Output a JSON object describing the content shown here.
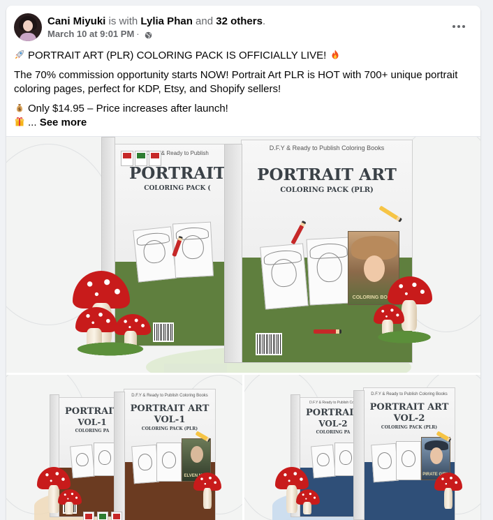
{
  "post": {
    "author": "Cani Miyuki",
    "with_text": "is with",
    "tagged": "Lylia Phan",
    "and_text": "and",
    "others": "32 others",
    "period": ".",
    "timestamp": "March 10 at 9:01 PM",
    "separator": "·",
    "audience_icon": "globe-icon",
    "more_icon": "more-options-icon"
  },
  "content": {
    "line1": "PORTRAIT ART (PLR) COLORING PACK IS OFFICIALLY LIVE!",
    "line2": "The 70% commission opportunity starts NOW! Portrait Art PLR is HOT with 700+ unique portrait coloring pages, perfect for KDP, Etsy, and Shopify sellers!",
    "line3": "Only $14.95 – Price increases after launch!",
    "line4_prefix": "...",
    "see_more": "See more",
    "emojis": [
      "rocket-emoji",
      "fire-emoji",
      "money-bag-emoji",
      "gift-emoji"
    ]
  },
  "images": {
    "main": {
      "tagline": "D.F.Y & Ready to Publish Coloring Books",
      "title": "PORTRAIT ART",
      "subtitle": "COLORING PACK (PLR)",
      "back_title": "PORTRAIT",
      "back_subtitle": "COLORING PACK (",
      "back_tagline": "D.F.Y & Ready to Publish",
      "cover_caption": "COLORING BOOK",
      "file_types": [
        "JPG",
        "PNG",
        "PDF"
      ]
    },
    "vol1": {
      "tagline": "D.F.Y & Ready to Publish Coloring Books",
      "title": "PORTRAIT ART",
      "volume": "VOL-1",
      "subtitle": "COLORING PACK (PLR)",
      "back_title": "PORTRAIT",
      "back_volume": "VOL-1",
      "back_subtitle": "COLORING PA",
      "cover_caption": "ELVEN MAN"
    },
    "vol2": {
      "tagline": "D.F.Y & Ready to Publish Coloring Books",
      "title": "PORTRAIT ART",
      "volume": "VOL-2",
      "subtitle": "COLORING PACK (PLR)",
      "back_title": "PORTRAIT",
      "back_volume": "VOL-2",
      "back_subtitle": "COLORING PA",
      "back_tagline": "D.F.Y & Ready to Publish Colo",
      "cover_caption": "PIRATE GIRL"
    }
  },
  "colors": {
    "name_text": "#050505",
    "muted_text": "#65676b",
    "band_green": "#5f7f3e",
    "band_brown": "#6b3b21",
    "band_blue": "#2f4f78",
    "mushroom_red": "#c81b1b"
  }
}
